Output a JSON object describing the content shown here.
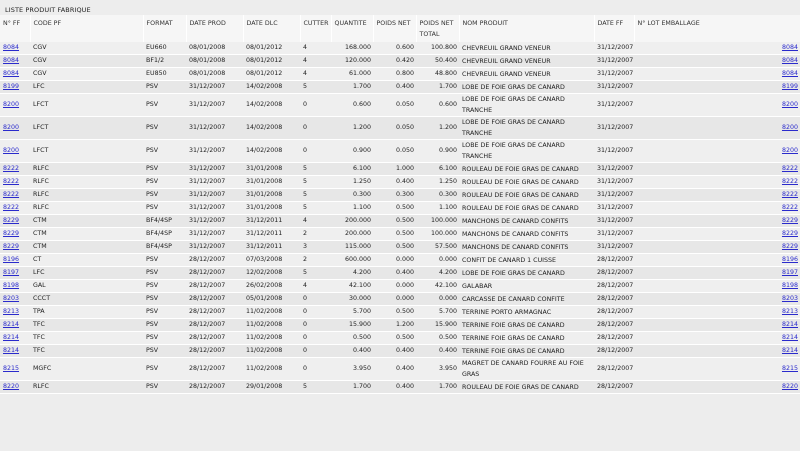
{
  "page_title": "LISTE PRODUIT FABRIQUE",
  "columns": [
    "N° FF",
    "CODE PF",
    "FORMAT",
    "DATE PROD",
    "DATE DLC",
    "CUTTER",
    "QUANTITE",
    "POIDS NET",
    "POIDS NET TOTAL",
    "NOM PRODUIT",
    "DATE FF",
    "N° LOT EMBALLAGE"
  ],
  "rows": [
    {
      "ff": "8084",
      "code": "CGV",
      "format": "EU660",
      "date_prod": "08/01/2008",
      "date_dlc": "08/01/2012",
      "cutter": "4",
      "quantite": "168.000",
      "poids_net": "0.600",
      "poids_net_total": "100.800",
      "nom": "CHEVREUIL GRAND VENEUR",
      "date_ff": "31/12/2007",
      "lot": "8084",
      "tall": false
    },
    {
      "ff": "8084",
      "code": "CGV",
      "format": "BF1/2",
      "date_prod": "08/01/2008",
      "date_dlc": "08/01/2012",
      "cutter": "4",
      "quantite": "120.000",
      "poids_net": "0.420",
      "poids_net_total": "50.400",
      "nom": "CHEVREUIL GRAND VENEUR",
      "date_ff": "31/12/2007",
      "lot": "8084",
      "tall": false
    },
    {
      "ff": "8084",
      "code": "CGV",
      "format": "EU850",
      "date_prod": "08/01/2008",
      "date_dlc": "08/01/2012",
      "cutter": "4",
      "quantite": "61.000",
      "poids_net": "0.800",
      "poids_net_total": "48.800",
      "nom": "CHEVREUIL GRAND VENEUR",
      "date_ff": "31/12/2007",
      "lot": "8084",
      "tall": false
    },
    {
      "ff": "8199",
      "code": "LFC",
      "format": "PSV",
      "date_prod": "31/12/2007",
      "date_dlc": "14/02/2008",
      "cutter": "5",
      "quantite": "1.700",
      "poids_net": "0.400",
      "poids_net_total": "1.700",
      "nom": "LOBE DE FOIE GRAS DE CANARD",
      "date_ff": "31/12/2007",
      "lot": "8199",
      "tall": false
    },
    {
      "ff": "8200",
      "code": "LFCT",
      "format": "PSV",
      "date_prod": "31/12/2007",
      "date_dlc": "14/02/2008",
      "cutter": "0",
      "quantite": "0.600",
      "poids_net": "0.050",
      "poids_net_total": "0.600",
      "nom": "LOBE DE FOIE GRAS DE CANARD TRANCHE",
      "date_ff": "31/12/2007",
      "lot": "8200",
      "tall": true
    },
    {
      "ff": "8200",
      "code": "LFCT",
      "format": "PSV",
      "date_prod": "31/12/2007",
      "date_dlc": "14/02/2008",
      "cutter": "0",
      "quantite": "1.200",
      "poids_net": "0.050",
      "poids_net_total": "1.200",
      "nom": "LOBE DE FOIE GRAS DE CANARD TRANCHE",
      "date_ff": "31/12/2007",
      "lot": "8200",
      "tall": true
    },
    {
      "ff": "8200",
      "code": "LFCT",
      "format": "PSV",
      "date_prod": "31/12/2007",
      "date_dlc": "14/02/2008",
      "cutter": "0",
      "quantite": "0.900",
      "poids_net": "0.050",
      "poids_net_total": "0.900",
      "nom": "LOBE DE FOIE GRAS DE CANARD TRANCHE",
      "date_ff": "31/12/2007",
      "lot": "8200",
      "tall": true
    },
    {
      "ff": "8222",
      "code": "RLFC",
      "format": "PSV",
      "date_prod": "31/12/2007",
      "date_dlc": "31/01/2008",
      "cutter": "5",
      "quantite": "6.100",
      "poids_net": "1.000",
      "poids_net_total": "6.100",
      "nom": "ROULEAU DE FOIE GRAS DE CANARD",
      "date_ff": "31/12/2007",
      "lot": "8222",
      "tall": false
    },
    {
      "ff": "8222",
      "code": "RLFC",
      "format": "PSV",
      "date_prod": "31/12/2007",
      "date_dlc": "31/01/2008",
      "cutter": "5",
      "quantite": "1.250",
      "poids_net": "0.400",
      "poids_net_total": "1.250",
      "nom": "ROULEAU DE FOIE GRAS DE CANARD",
      "date_ff": "31/12/2007",
      "lot": "8222",
      "tall": false
    },
    {
      "ff": "8222",
      "code": "RLFC",
      "format": "PSV",
      "date_prod": "31/12/2007",
      "date_dlc": "31/01/2008",
      "cutter": "5",
      "quantite": "0.300",
      "poids_net": "0.300",
      "poids_net_total": "0.300",
      "nom": "ROULEAU DE FOIE GRAS DE CANARD",
      "date_ff": "31/12/2007",
      "lot": "8222",
      "tall": false
    },
    {
      "ff": "8222",
      "code": "RLFC",
      "format": "PSV",
      "date_prod": "31/12/2007",
      "date_dlc": "31/01/2008",
      "cutter": "5",
      "quantite": "1.100",
      "poids_net": "0.500",
      "poids_net_total": "1.100",
      "nom": "ROULEAU DE FOIE GRAS DE CANARD",
      "date_ff": "31/12/2007",
      "lot": "8222",
      "tall": false
    },
    {
      "ff": "8229",
      "code": "CTM",
      "format": "BF4/4SP",
      "date_prod": "31/12/2007",
      "date_dlc": "31/12/2011",
      "cutter": "4",
      "quantite": "200.000",
      "poids_net": "0.500",
      "poids_net_total": "100.000",
      "nom": "MANCHONS DE CANARD CONFITS",
      "date_ff": "31/12/2007",
      "lot": "8229",
      "tall": false
    },
    {
      "ff": "8229",
      "code": "CTM",
      "format": "BF4/4SP",
      "date_prod": "31/12/2007",
      "date_dlc": "31/12/2011",
      "cutter": "2",
      "quantite": "200.000",
      "poids_net": "0.500",
      "poids_net_total": "100.000",
      "nom": "MANCHONS DE CANARD CONFITS",
      "date_ff": "31/12/2007",
      "lot": "8229",
      "tall": false
    },
    {
      "ff": "8229",
      "code": "CTM",
      "format": "BF4/4SP",
      "date_prod": "31/12/2007",
      "date_dlc": "31/12/2011",
      "cutter": "3",
      "quantite": "115.000",
      "poids_net": "0.500",
      "poids_net_total": "57.500",
      "nom": "MANCHONS DE CANARD CONFITS",
      "date_ff": "31/12/2007",
      "lot": "8229",
      "tall": false
    },
    {
      "ff": "8196",
      "code": "CT",
      "format": "PSV",
      "date_prod": "28/12/2007",
      "date_dlc": "07/03/2008",
      "cutter": "2",
      "quantite": "600.000",
      "poids_net": "0.000",
      "poids_net_total": "0.000",
      "nom": "CONFIT DE CANARD 1 CUISSE",
      "date_ff": "28/12/2007",
      "lot": "8196",
      "tall": false
    },
    {
      "ff": "8197",
      "code": "LFC",
      "format": "PSV",
      "date_prod": "28/12/2007",
      "date_dlc": "12/02/2008",
      "cutter": "5",
      "quantite": "4.200",
      "poids_net": "0.400",
      "poids_net_total": "4.200",
      "nom": "LOBE DE FOIE GRAS DE CANARD",
      "date_ff": "28/12/2007",
      "lot": "8197",
      "tall": false
    },
    {
      "ff": "8198",
      "code": "GAL",
      "format": "PSV",
      "date_prod": "28/12/2007",
      "date_dlc": "26/02/2008",
      "cutter": "4",
      "quantite": "42.100",
      "poids_net": "0.000",
      "poids_net_total": "42.100",
      "nom": "GALABAR",
      "date_ff": "28/12/2007",
      "lot": "8198",
      "tall": false
    },
    {
      "ff": "8203",
      "code": "CCCT",
      "format": "PSV",
      "date_prod": "28/12/2007",
      "date_dlc": "05/01/2008",
      "cutter": "0",
      "quantite": "30.000",
      "poids_net": "0.000",
      "poids_net_total": "0.000",
      "nom": "CARCASSE DE CANARD CONFITE",
      "date_ff": "28/12/2007",
      "lot": "8203",
      "tall": false
    },
    {
      "ff": "8213",
      "code": "TPA",
      "format": "PSV",
      "date_prod": "28/12/2007",
      "date_dlc": "11/02/2008",
      "cutter": "0",
      "quantite": "5.700",
      "poids_net": "0.500",
      "poids_net_total": "5.700",
      "nom": "TERRINE PORTO ARMAGNAC",
      "date_ff": "28/12/2007",
      "lot": "8213",
      "tall": false
    },
    {
      "ff": "8214",
      "code": "TFC",
      "format": "PSV",
      "date_prod": "28/12/2007",
      "date_dlc": "11/02/2008",
      "cutter": "0",
      "quantite": "15.900",
      "poids_net": "1.200",
      "poids_net_total": "15.900",
      "nom": "TERRINE FOIE GRAS DE CANARD",
      "date_ff": "28/12/2007",
      "lot": "8214",
      "tall": false
    },
    {
      "ff": "8214",
      "code": "TFC",
      "format": "PSV",
      "date_prod": "28/12/2007",
      "date_dlc": "11/02/2008",
      "cutter": "0",
      "quantite": "0.500",
      "poids_net": "0.500",
      "poids_net_total": "0.500",
      "nom": "TERRINE FOIE GRAS DE CANARD",
      "date_ff": "28/12/2007",
      "lot": "8214",
      "tall": false
    },
    {
      "ff": "8214",
      "code": "TFC",
      "format": "PSV",
      "date_prod": "28/12/2007",
      "date_dlc": "11/02/2008",
      "cutter": "0",
      "quantite": "0.400",
      "poids_net": "0.400",
      "poids_net_total": "0.400",
      "nom": "TERRINE FOIE GRAS DE CANARD",
      "date_ff": "28/12/2007",
      "lot": "8214",
      "tall": false
    },
    {
      "ff": "8215",
      "code": "MGFC",
      "format": "PSV",
      "date_prod": "28/12/2007",
      "date_dlc": "11/02/2008",
      "cutter": "0",
      "quantite": "3.950",
      "poids_net": "0.400",
      "poids_net_total": "3.950",
      "nom": "MAGRET DE CANARD FOURRE AU FOIE GRAS",
      "date_ff": "28/12/2007",
      "lot": "8215",
      "tall": true
    },
    {
      "ff": "8220",
      "code": "RLFC",
      "format": "PSV",
      "date_prod": "28/12/2007",
      "date_dlc": "29/01/2008",
      "cutter": "5",
      "quantite": "1.700",
      "poids_net": "0.400",
      "poids_net_total": "1.700",
      "nom": "ROULEAU DE FOIE GRAS DE CANARD",
      "date_ff": "28/12/2007",
      "lot": "8220",
      "tall": false
    }
  ]
}
